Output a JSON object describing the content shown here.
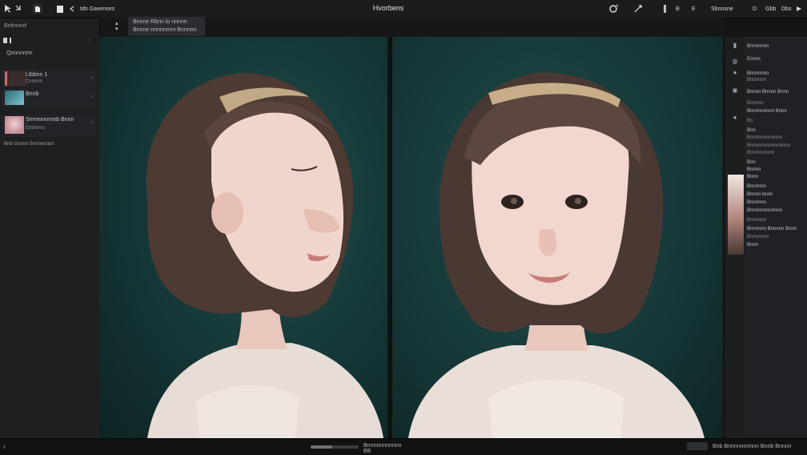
{
  "window": {
    "title": "Hvorbens"
  },
  "toolbar": {
    "left_label": "tdn  Gavenses",
    "right_items": [
      "O",
      "B",
      "E",
      "Sbnnsne",
      "D",
      "Gbb",
      "Dbs",
      "▶"
    ]
  },
  "tooltip": {
    "line1": "Bnnne  Rbnn  lo  nnnnn",
    "line2": "Bnnne  nnnnnnnn  Bnnnnn"
  },
  "left_panel": {
    "header": "Bnbnnnd",
    "subheader": "Qnnnnnnn",
    "layers": [
      {
        "label": "Ltbbnn 1",
        "sub": "Cnnnnn",
        "color": "#d36a6a"
      },
      {
        "label": "Bnnb",
        "sub": "",
        "color": "#5aa6b3"
      },
      {
        "label": "Srnnnnnnnnb  Bnnn",
        "sub": "Enbnnns",
        "color": "#e2b8bd"
      }
    ],
    "footer": "Bnb  Gnnnn   Bnnnnnnnn"
  },
  "right_props": [
    {
      "t": "Bnnnnnnn",
      "dim": false
    },
    {
      "t": "Ennns",
      "dim": false
    },
    {
      "t": "Bnnnnnnn",
      "dim": false
    },
    {
      "t": "Bnbnnnn",
      "dim": true
    },
    {
      "t": "Bnnnn  Bnnnn  Bnnn",
      "dim": false
    },
    {
      "t": "Bnnnnn",
      "dim": true
    },
    {
      "t": "Bnnnnnnnnn  Bnnn",
      "dim": false
    },
    {
      "t": "Bn",
      "dim": true
    },
    {
      "t": "Bnn",
      "dim": false
    },
    {
      "t": "Bnnnnnnnnnnnn",
      "dim": true
    },
    {
      "t": "Bnnnnnnnnnnnnnnn",
      "dim": true
    },
    {
      "t": "Bnnnnnnnnn",
      "dim": true
    },
    {
      "t": "Bnn",
      "dim": false
    },
    {
      "t": "Bnnnn",
      "dim": false
    },
    {
      "t": "Bnnn",
      "dim": false
    },
    {
      "t": "Bnnnnnn",
      "dim": false
    },
    {
      "t": "Bnnnn  bnnn",
      "dim": false
    },
    {
      "t": "Bnnnnnn",
      "dim": false
    },
    {
      "t": "Bnnnnnnnnnnnn",
      "dim": false
    },
    {
      "t": "Bnnnnnn",
      "dim": true
    },
    {
      "t": "Bnnnnnn  Bnnnnn  Bnnn",
      "dim": false
    },
    {
      "t": "Bnnnnnnn",
      "dim": true
    },
    {
      "t": "Bnnn",
      "dim": false
    }
  ],
  "bottom": {
    "zoom_label": "Bnnnnnnnnnnn  BB",
    "zoom_fraction": 0.45,
    "status": "Bnb  Bnnnnnnnnnn  Bnnb  Bnnnn"
  },
  "icons": {
    "toolbar_left": [
      "cursor-icon",
      "file-icon",
      "page-icon",
      "arrow-icon"
    ],
    "toolbar_right": [
      "brush-icon",
      "pen-icon",
      "grid-icon",
      "eye-icon",
      "play-icon"
    ],
    "rightstrip": [
      "layers-icon",
      "adjust-icon",
      "mask-icon",
      "history-icon"
    ]
  }
}
